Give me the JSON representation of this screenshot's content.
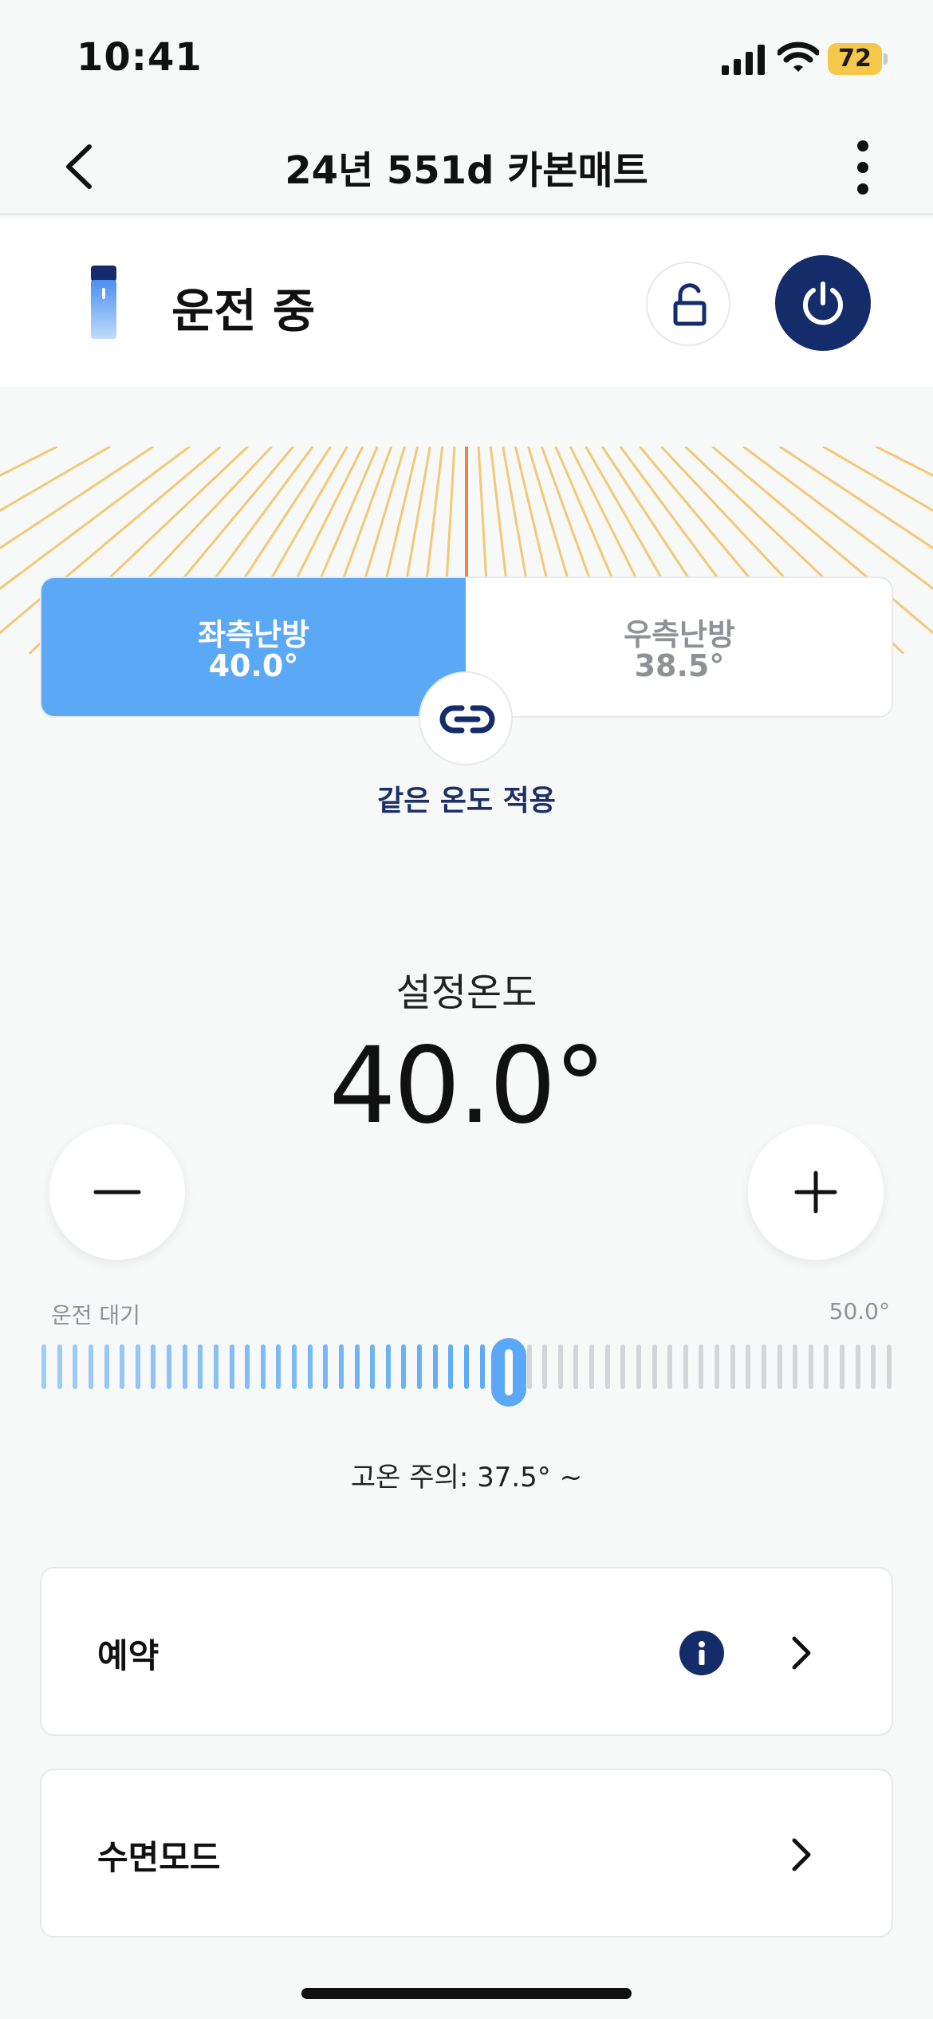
{
  "status_bar": {
    "time": "10:41",
    "battery": "72",
    "battery_color": "#f5c84a"
  },
  "nav": {
    "title": "24년 551d 카본매트",
    "back_icon": "chevron-left-icon",
    "menu_icon": "more-vertical-icon"
  },
  "device": {
    "status": "운전 중",
    "lock_icon": "unlock-icon",
    "power_icon": "power-icon",
    "accent": "#152c6b"
  },
  "zones": {
    "left": {
      "name": "좌측난방",
      "temp": "40.0°",
      "selected": true,
      "color": "#5aa8f6"
    },
    "right": {
      "name": "우측난방",
      "temp": "38.5°",
      "selected": false
    },
    "link_icon": "link-icon",
    "link_label": "같은 온도 적용"
  },
  "setpoint": {
    "label": "설정온도",
    "value": "40.0°",
    "minus_icon": "minus-icon",
    "plus_icon": "plus-icon"
  },
  "slider": {
    "min_label": "운전 대기",
    "max_label": "50.0°",
    "level": 0.55,
    "active_color": "#5aa8f6",
    "inactive_color": "#d3d5d8"
  },
  "warning": "고온 주의: 37.5° ~",
  "menu": [
    {
      "label": "예약",
      "info_icon": "info-icon",
      "chevron": "chevron-right-icon"
    },
    {
      "label": "수면모드",
      "chevron": "chevron-right-icon"
    }
  ]
}
